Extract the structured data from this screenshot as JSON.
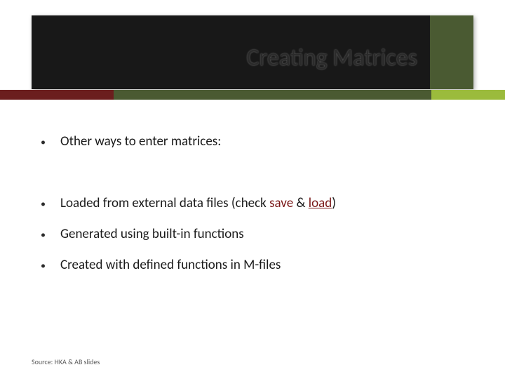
{
  "header": {
    "title": "Creating Matrices"
  },
  "content": {
    "items": [
      {
        "text": "Other ways to enter matrices:"
      },
      {
        "prefix": "Loaded from external data files (check ",
        "save": "save",
        "amp": " & ",
        "load": "load",
        "suffix": ")"
      },
      {
        "text": "Generated using built-in functions"
      },
      {
        "text": "Created with defined functions in M-files"
      }
    ]
  },
  "footer": {
    "source": "Source: HKA & AB slides"
  },
  "bullet": "•"
}
